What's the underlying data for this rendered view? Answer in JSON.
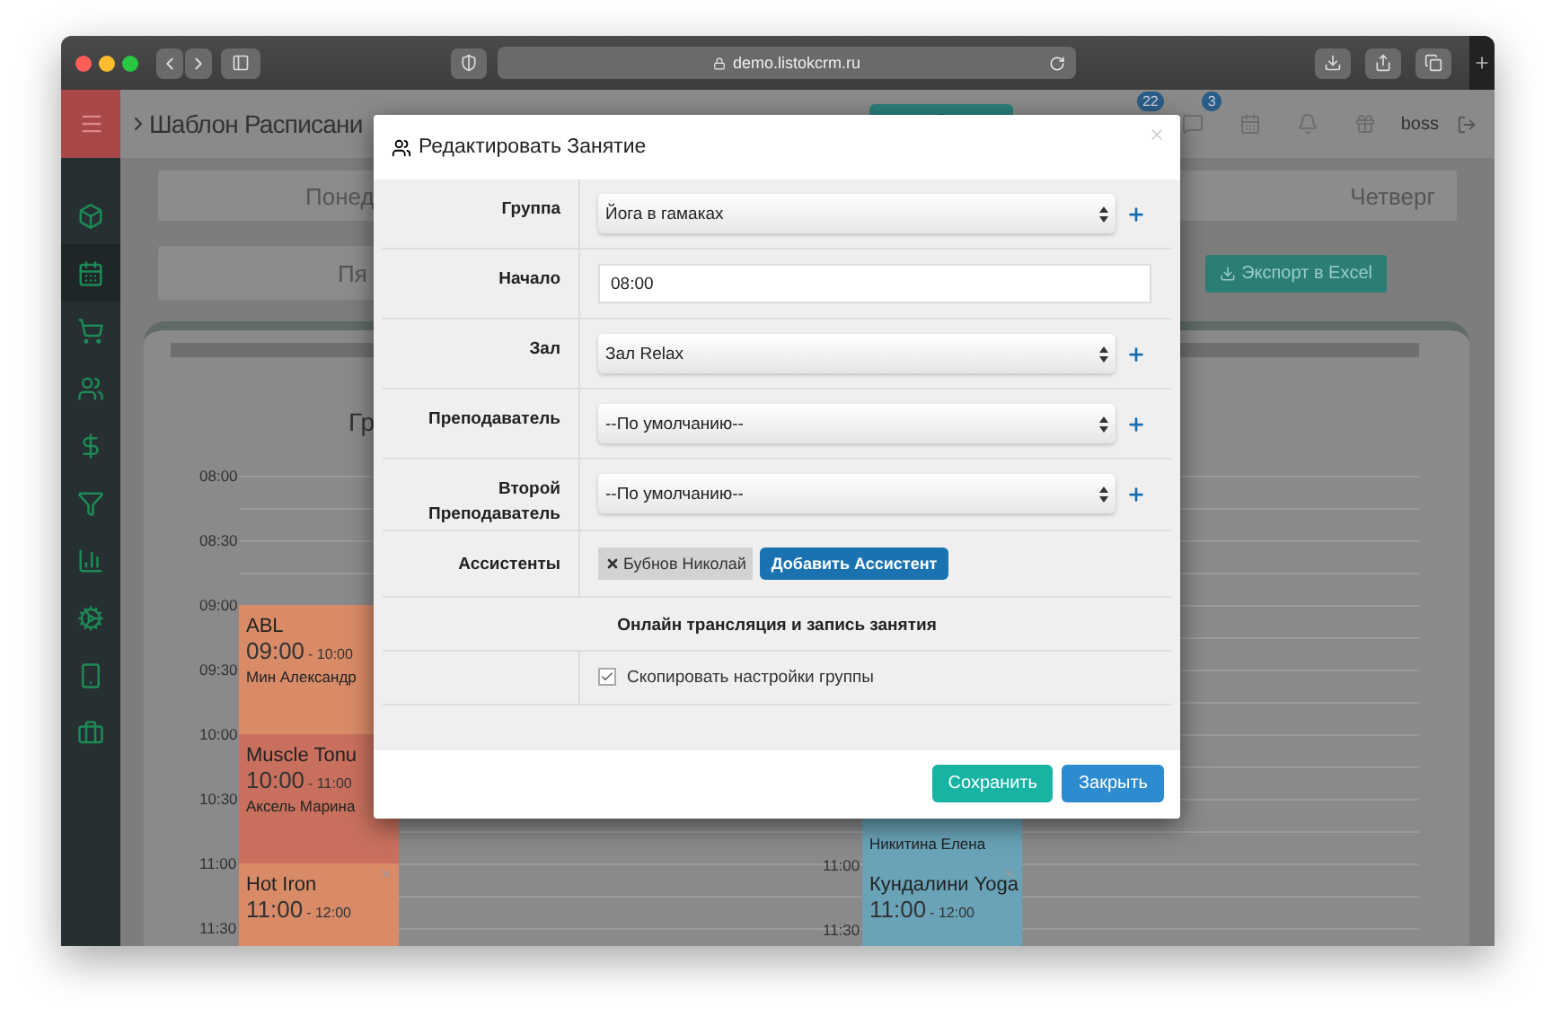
{
  "browser": {
    "url": "demo.listokcrm.ru"
  },
  "app": {
    "page_title": "Шаблон Расписани",
    "header": {
      "badges": [
        "22",
        "3"
      ],
      "user": "boss"
    },
    "days_row_1": [
      "Понед",
      "Четверг"
    ],
    "days_row_2": [
      "Пя"
    ],
    "export_button": "Экспорт в Excel",
    "schedule": {
      "title": "Гр",
      "times_left": [
        "08:00",
        "08:30",
        "09:00",
        "09:30",
        "10:00",
        "10:30",
        "11:00",
        "11:30"
      ],
      "times_right": [
        "11:00",
        "11:30"
      ],
      "events_left": [
        {
          "title": "ABL",
          "start": "09:00",
          "end": "- 10:00",
          "teacher": "Мин Александр",
          "color": "#d98b68"
        },
        {
          "title": "Muscle Tonu",
          "start": "10:00",
          "end": "- 11:00",
          "teacher": "Аксель Марина",
          "color": "#c8705d"
        },
        {
          "title": "Hot Iron",
          "start": "11:00",
          "end": "- 12:00",
          "color": "#d98b68"
        }
      ],
      "events_right": [
        {
          "teacher": "Никитина Елена",
          "color": "#6aa3b8"
        },
        {
          "title": "Кундалини Yoga",
          "start": "11:00",
          "end": "- 12:00",
          "color": "#6aa3b8"
        }
      ]
    }
  },
  "modal": {
    "title": "Редактировать Занятие",
    "fields": [
      {
        "label": "Группа",
        "kind": "select",
        "value": "Йога в гамаках"
      },
      {
        "label": "Начало",
        "kind": "input",
        "value": "08:00"
      },
      {
        "label": "Зал",
        "kind": "select",
        "value": "Зал Relax"
      },
      {
        "label": "Преподаватель",
        "kind": "select",
        "value": "--По умолчанию--"
      },
      {
        "label": "Второй Преподаватель",
        "kind": "select",
        "value": "--По умолчанию--"
      },
      {
        "label": "Ассистенты",
        "kind": "assistants",
        "chips": [
          "Бубнов Николай"
        ],
        "button": "Добавить Ассистент"
      }
    ],
    "section_title": "Онлайн трансляция и запись занятия",
    "copy_settings": {
      "label": "Скопировать настройки группы",
      "checked": true
    },
    "buttons": [
      {
        "label": "Сохранить",
        "kind": "primary"
      },
      {
        "label": "Закрыть",
        "kind": "secondary"
      }
    ]
  }
}
